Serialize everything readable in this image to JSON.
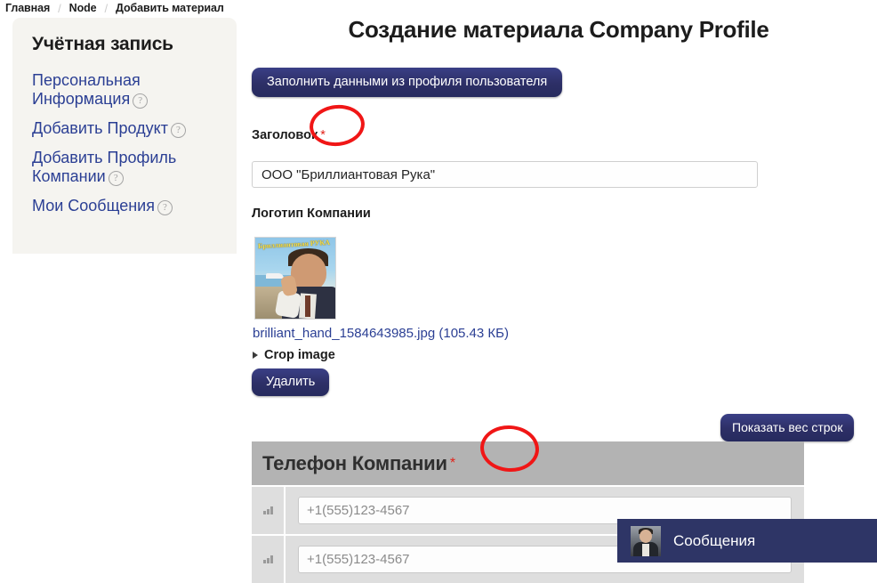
{
  "breadcrumb": {
    "separator": "/",
    "items": [
      "Главная",
      "Node",
      "Добавить материал"
    ]
  },
  "sidebar": {
    "heading": "Учётная запись",
    "help_glyph": "?",
    "items": [
      {
        "label": "Персональная Информация"
      },
      {
        "label": "Добавить Продукт"
      },
      {
        "label": "Добавить Профиль Компании"
      },
      {
        "label": "Мои Сообщения"
      }
    ]
  },
  "main": {
    "page_title": "Создание материала Company Profile",
    "fill_profile_button": "Заполнить данными из профиля пользователя",
    "required_star": "*",
    "title_field": {
      "label": "Заголовок",
      "value": "ООО \"Бриллиантовая Рука\""
    },
    "logo_field": {
      "label": "Логотип Компании",
      "file_name": "brilliant_hand_1584643985.jpg",
      "file_size": "(105.43 КБ)",
      "crop_label": "Crop image",
      "delete_button": "Удалить",
      "poster_caption": "Бриллиантовая РУКА"
    },
    "show_weights_button": "Показать вес строк",
    "phone_section": {
      "header": "Телефон Компании",
      "rows": [
        {
          "value": "",
          "placeholder": "+1(555)123-4567"
        },
        {
          "value": "",
          "placeholder": "+1(555)123-4567"
        }
      ]
    }
  },
  "messages_widget": {
    "label": "Сообщения"
  },
  "colors": {
    "accent_button": "#2d2f66",
    "link": "#2b3f94",
    "required": "#e2231a",
    "annotation": "#f01616",
    "section_header_bg": "#b3b3b3",
    "sidebar_bg": "#f5f4f0",
    "chat_bar_bg": "#2e3566"
  }
}
